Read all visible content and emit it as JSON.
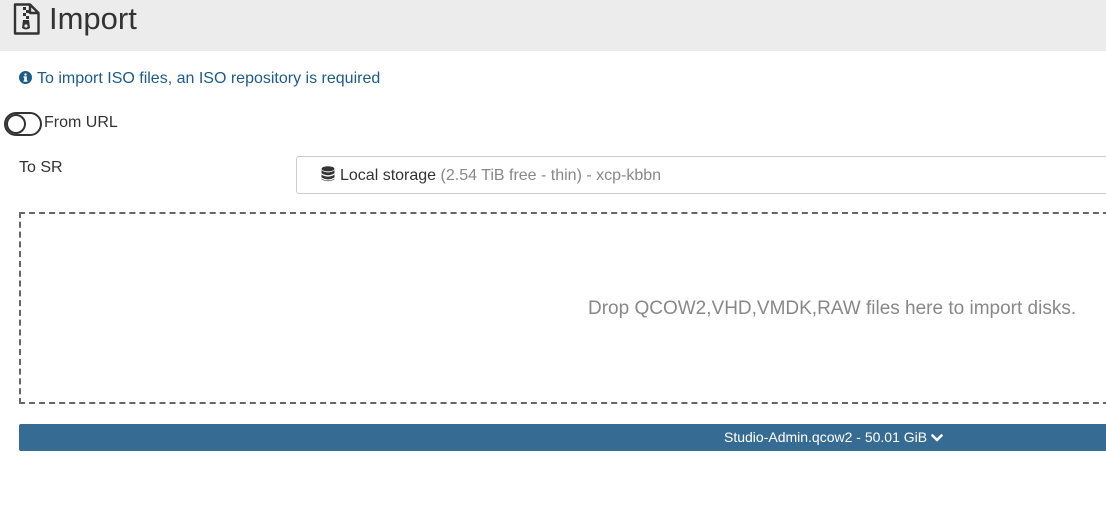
{
  "header": {
    "icon": "file-archive-icon",
    "title": "Import"
  },
  "notice": {
    "icon": "info-circle-icon",
    "text": "To import ISO files, an ISO repository is required",
    "color": "#1c5c87"
  },
  "from_url": {
    "label": "From URL",
    "enabled": false
  },
  "to_sr": {
    "label": "To SR",
    "icon": "database-icon",
    "selected_name": "Local storage",
    "selected_detail": "(2.54 TiB free - thin) - xcp-kbbn"
  },
  "dropzone": {
    "text": "Drop QCOW2,VHD,VMDK,RAW files here to import disks."
  },
  "file": {
    "label": "Studio-Admin.qcow2 - 50.01 GiB",
    "icon": "chevron-down-icon",
    "color": "#366c94"
  }
}
